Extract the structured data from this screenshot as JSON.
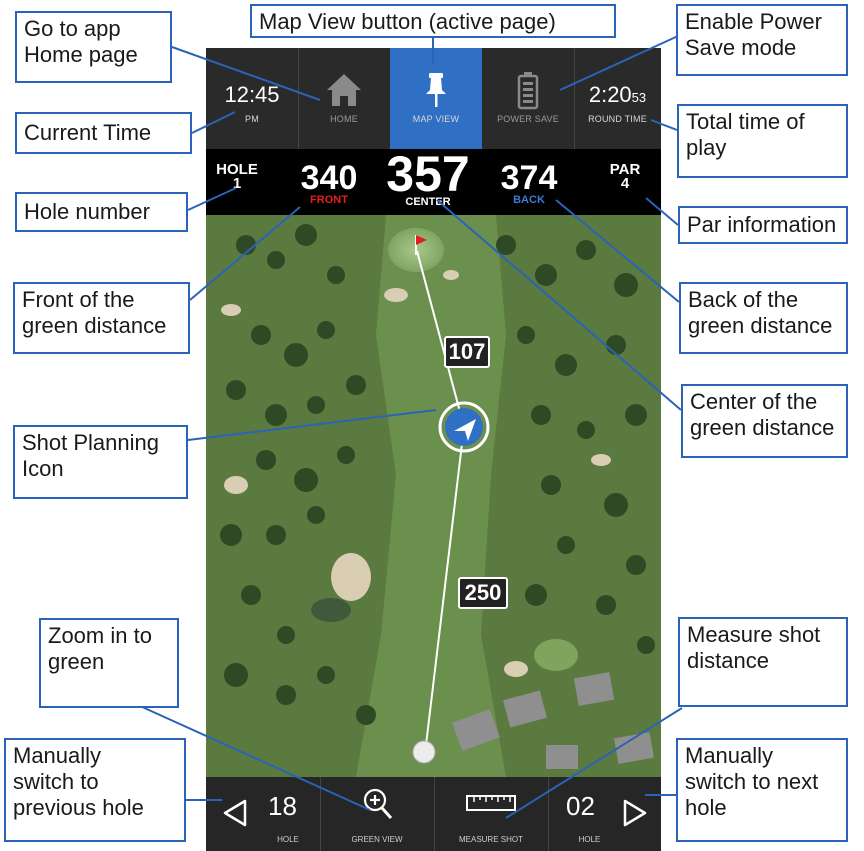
{
  "status": {
    "time": "12:45",
    "ampm": "PM",
    "home_label": "HOME",
    "map_view_label": "MAP VIEW",
    "power_save_label": "POWER SAVE",
    "round_time_main": "2:20",
    "round_time_secs": "53",
    "round_time_label": "ROUND TIME"
  },
  "distances": {
    "hole_label": "HOLE",
    "hole_number": "1",
    "front": "340",
    "front_label": "FRONT",
    "center": "357",
    "center_label": "CENTER",
    "back": "374",
    "back_label": "BACK",
    "par_label": "PAR",
    "par_value": "4"
  },
  "map": {
    "marker_near_green": "107",
    "marker_fairway": "250"
  },
  "bottom": {
    "prev_hole": "18",
    "prev_label": "HOLE",
    "green_view_label": "GREEN VIEW",
    "measure_shot_label": "MEASURE SHOT",
    "next_hole": "02",
    "next_label": "HOLE"
  },
  "icons": [
    "home-icon",
    "pin-icon",
    "battery-icon",
    "zoom-in-icon",
    "ruler-icon",
    "prev-arrow-icon",
    "next-arrow-icon",
    "shot-planning-icon",
    "flag-icon"
  ],
  "colors": {
    "accent_blue": "#2f6fc4",
    "callout_border": "#2a63b8",
    "front_red": "#e02020",
    "back_blue": "#3a7bd5"
  },
  "callouts": {
    "home": "Go to app\nHome page",
    "map_view": "Map View button (active page)",
    "power": "Enable Power\nSave mode",
    "current_time": "Current Time",
    "total_time": "Total time of\nplay",
    "hole_number": "Hole number",
    "par": "Par information",
    "front": "Front of the\ngreen distance",
    "back": "Back of the\ngreen distance",
    "shot_planning": "Shot Planning\nIcon",
    "center": "Center of the\ngreen distance",
    "zoom": "Zoom in to\ngreen",
    "measure": "Measure shot\ndistance",
    "prev_hole": "Manually\nswitch to\nprevious hole",
    "next_hole": "Manually\nswitch to next\nhole"
  }
}
